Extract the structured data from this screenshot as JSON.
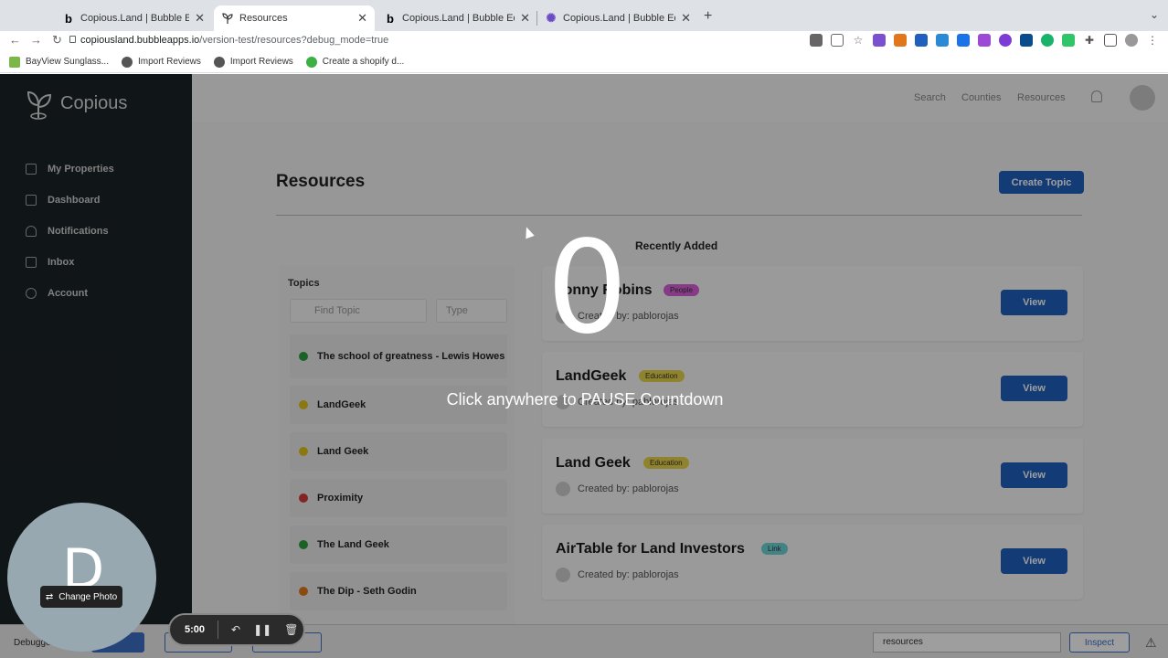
{
  "browser": {
    "tabs": [
      {
        "title": "Copious.Land | Bubble Editor",
        "favicon": "bubble-icon"
      },
      {
        "title": "Resources",
        "favicon": "copious-sprout-icon"
      },
      {
        "title": "Copious.Land | Bubble Editor",
        "favicon": "bubble-icon"
      },
      {
        "title": "Copious.Land | Bubble Editor -",
        "favicon": "gear-flower-icon"
      }
    ],
    "url_host": "copiousland.bubbleapps.io",
    "url_path": "/version-test/resources?debug_mode=true",
    "bookmarks": [
      {
        "label": "BayView Sunglass...",
        "icon": "shopify-icon",
        "color": "#7ab648"
      },
      {
        "label": "Import Reviews",
        "icon": "globe-icon",
        "color": "#555555"
      },
      {
        "label": "Import Reviews",
        "icon": "globe-icon",
        "color": "#555555"
      },
      {
        "label": "Create a shopify d...",
        "icon": "app-icon",
        "color": "#3cb043"
      }
    ]
  },
  "sidebar": {
    "brand": "Copious",
    "items": [
      {
        "label": "My Properties",
        "icon": "home-icon"
      },
      {
        "label": "Dashboard",
        "icon": "dashboard-icon"
      },
      {
        "label": "Notifications",
        "icon": "bell-icon"
      },
      {
        "label": "Inbox",
        "icon": "inbox-icon"
      },
      {
        "label": "Account",
        "icon": "gear-icon"
      }
    ]
  },
  "topnav": {
    "links": [
      "Search",
      "Counties",
      "Resources"
    ]
  },
  "page": {
    "title": "Resources",
    "create_button": "Create Topic",
    "recent_title": "Recently Added"
  },
  "topics": {
    "label": "Topics",
    "search_placeholder": "Find Topic",
    "type_placeholder": "Type",
    "items": [
      {
        "label": "The school of greatness - Lewis Howes",
        "color": "#2e9e3e"
      },
      {
        "label": "LandGeek",
        "color": "#e0c21a"
      },
      {
        "label": "Land Geek",
        "color": "#e0c21a"
      },
      {
        "label": "Proximity",
        "color": "#d43a3a"
      },
      {
        "label": "The Land Geek",
        "color": "#2e9e3e"
      },
      {
        "label": "The Dip - Seth Godin",
        "color": "#e07a1a"
      }
    ]
  },
  "resources": [
    {
      "title": "Tonny Robins",
      "badge": "People",
      "badge_color": "#d95fd9",
      "creator": "Created by: pablorojas",
      "view": "View"
    },
    {
      "title": "LandGeek",
      "badge": "Education",
      "badge_color": "#e8d34a",
      "creator": "Created by: pablorojas",
      "view": "View"
    },
    {
      "title": "Land Geek",
      "badge": "Education",
      "badge_color": "#e8d34a",
      "creator": "Created by: pablorojas",
      "view": "View"
    },
    {
      "title": "AirTable for Land Investors",
      "badge": "Link",
      "badge_color": "#6fd3d6",
      "creator": "Created by: pablorojas",
      "view": "View"
    }
  ],
  "debugger": {
    "label": "Debugger",
    "select_value": "resources",
    "inspect": "Inspect"
  },
  "overlay": {
    "countdown": "0",
    "hint": "Click anywhere to PAUSE Countdown",
    "camera_initial": "D",
    "change_photo": "Change Photo",
    "timer": "5:00"
  }
}
